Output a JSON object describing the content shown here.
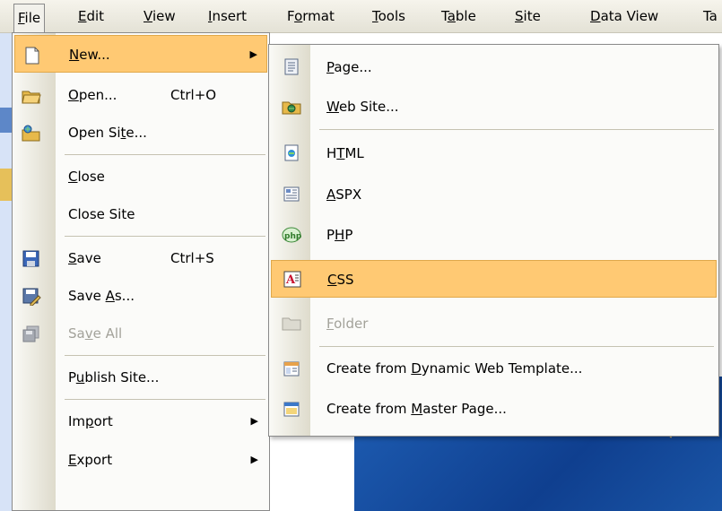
{
  "menubar": {
    "items": [
      {
        "label": "File"
      },
      {
        "label": "Edit"
      },
      {
        "label": "View"
      },
      {
        "label": "Insert"
      },
      {
        "label": "Format"
      },
      {
        "label": "Tools"
      },
      {
        "label": "Table"
      },
      {
        "label": "Site"
      },
      {
        "label": "Data View"
      },
      {
        "label": "Ta"
      }
    ]
  },
  "file_menu": {
    "items": [
      {
        "label": "New...",
        "icon": "new-document-icon",
        "submenu": true,
        "highlighted": true
      },
      {
        "label": "Open...",
        "shortcut": "Ctrl+O",
        "icon": "open-folder-icon"
      },
      {
        "label": "Open Site...",
        "icon": "open-site-icon"
      },
      {
        "label": "Close"
      },
      {
        "label": "Close Site"
      },
      {
        "label": "Save",
        "shortcut": "Ctrl+S",
        "icon": "save-icon"
      },
      {
        "label": "Save As...",
        "icon": "save-as-icon"
      },
      {
        "label": "Save All",
        "icon": "save-all-icon",
        "disabled": true
      },
      {
        "label": "Publish Site..."
      },
      {
        "label": "Import",
        "submenu": true
      },
      {
        "label": "Export",
        "submenu": true
      }
    ]
  },
  "new_menu": {
    "items": [
      {
        "label": "Page...",
        "icon": "page-icon"
      },
      {
        "label": "Web Site...",
        "icon": "web-site-icon"
      },
      {
        "label": "HTML",
        "icon": "html-icon"
      },
      {
        "label": "ASPX",
        "icon": "aspx-icon"
      },
      {
        "label": "PHP",
        "icon": "php-icon"
      },
      {
        "label": "CSS",
        "icon": "css-icon",
        "highlighted": true
      },
      {
        "label": "Folder",
        "icon": "folder-icon",
        "disabled": true
      },
      {
        "label": "Create from Dynamic Web Template...",
        "icon": "dynamic-web-template-icon"
      },
      {
        "label": "Create from Master Page...",
        "icon": "master-page-icon"
      }
    ]
  },
  "colors": {
    "highlight": "#ffc973",
    "highlight_border": "#e0a84a",
    "disabled_text": "#a3a29a",
    "menubar": "#ece9d8"
  }
}
